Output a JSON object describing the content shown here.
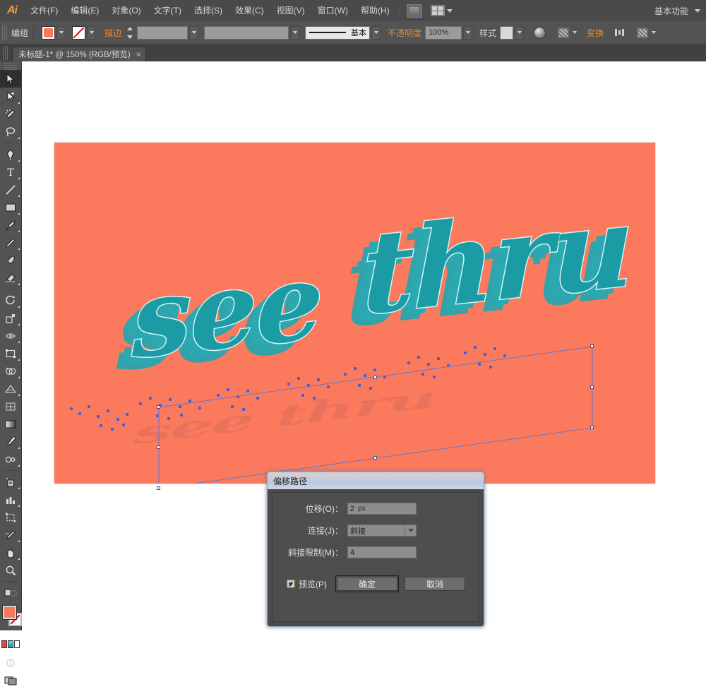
{
  "app": {
    "logo": "Ai",
    "menus": [
      "文件(F)",
      "编辑(E)",
      "对象(O)",
      "文字(T)",
      "选择(S)",
      "效果(C)",
      "视图(V)",
      "窗口(W)",
      "帮助(H)"
    ],
    "bridge_icon": "bridge-icon",
    "arrange_icon": "arrange-documents-icon",
    "workspace": "基本功能"
  },
  "control_bar": {
    "selection_label": "编组",
    "fill_color": "#f9795c",
    "fill_icon": "fill-swatch",
    "stroke_icon": "stroke-none-swatch",
    "stroke_label": "描边",
    "stroke_weight": "",
    "profile": "",
    "brush": "",
    "style_line_label": "基本",
    "opacity_label": "不透明度",
    "opacity_value": "100%",
    "style_label": "样式",
    "transform_label": "变换",
    "recolor_icon": "recolor-artwork-icon",
    "mask_icon": "opacity-mask-icon",
    "align_icon": "align-icon",
    "arrange_icon": "arrange-icon"
  },
  "tabs": [
    {
      "title": "未标题-1* @ 150% (RGB/预览)",
      "close": "×"
    }
  ],
  "toolbar": {
    "tools": [
      {
        "name": "selection-tool",
        "active": true
      },
      {
        "name": "direct-selection-tool",
        "active": false
      },
      {
        "name": "magic-wand-tool",
        "active": false
      },
      {
        "name": "lasso-tool",
        "active": false
      },
      {
        "name": "pen-tool",
        "active": false
      },
      {
        "name": "type-tool",
        "active": false
      },
      {
        "name": "line-segment-tool",
        "active": false
      },
      {
        "name": "rectangle-tool",
        "active": false
      },
      {
        "name": "paintbrush-tool",
        "active": false
      },
      {
        "name": "pencil-tool",
        "active": false
      },
      {
        "name": "blob-brush-tool",
        "active": false
      },
      {
        "name": "eraser-tool",
        "active": false
      },
      {
        "name": "rotate-tool",
        "active": false
      },
      {
        "name": "scale-tool",
        "active": false
      },
      {
        "name": "width-tool",
        "active": false
      },
      {
        "name": "free-transform-tool",
        "active": false
      },
      {
        "name": "shape-builder-tool",
        "active": false
      },
      {
        "name": "perspective-grid-tool",
        "active": false
      },
      {
        "name": "mesh-tool",
        "active": false
      },
      {
        "name": "gradient-tool",
        "active": false
      },
      {
        "name": "eyedropper-tool",
        "active": false
      },
      {
        "name": "blend-tool",
        "active": false
      },
      {
        "name": "symbol-sprayer-tool",
        "active": false
      },
      {
        "name": "column-graph-tool",
        "active": false
      },
      {
        "name": "artboard-tool",
        "active": false
      },
      {
        "name": "slice-tool",
        "active": false
      },
      {
        "name": "hand-tool",
        "active": false
      },
      {
        "name": "zoom-tool",
        "active": false
      }
    ],
    "fill_color": "#f9795c",
    "stroke_color": "none",
    "color_modes": [
      "color-icon",
      "gradient-icon",
      "none-icon"
    ],
    "draw_mode_icon": "draw-normal-icon",
    "screen_mode_icon": "screen-mode-icon"
  },
  "artwork": {
    "background_color": "#fb7a5e",
    "text_front": "see thru",
    "word_one": "see",
    "word_two": "thru",
    "face_color": "#1b9ba4",
    "outline_color": "#d8f3f6",
    "extrude_color": "#2aa5ac",
    "shadow_color": "#e2705c",
    "reflection_text": "see thru"
  },
  "dialog": {
    "title": "偏移路径",
    "fields": [
      {
        "label": "位移(O)：",
        "value": "2",
        "unit": "px",
        "type": "input"
      },
      {
        "label": "连接(J)：",
        "value": "斜接",
        "type": "select"
      },
      {
        "label": "斜接限制(M)：",
        "value": "4",
        "type": "input"
      }
    ],
    "preview_label": "预览(P)",
    "preview_checked": true,
    "ok_label": "确定",
    "cancel_label": "取消"
  }
}
